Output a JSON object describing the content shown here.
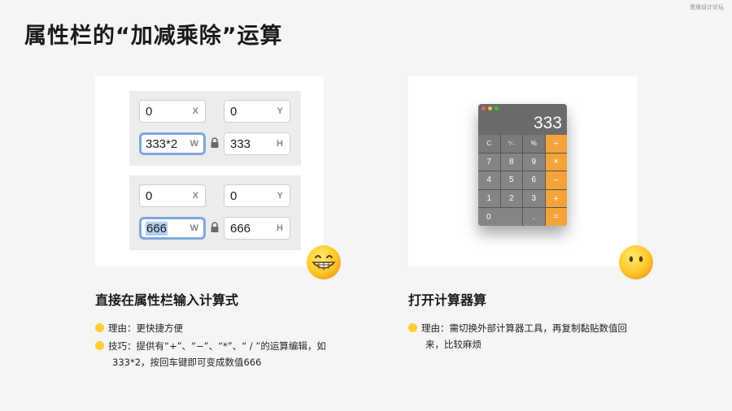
{
  "watermark": "思缘设计论坛",
  "page_title": "属性栏的“加减乘除”运算",
  "left_card": {
    "group1": {
      "x": {
        "value": "0",
        "label": "X"
      },
      "y": {
        "value": "0",
        "label": "Y"
      },
      "w": {
        "value": "333*2",
        "label": "W"
      },
      "h": {
        "value": "333",
        "label": "H"
      }
    },
    "group2": {
      "x": {
        "value": "0",
        "label": "X"
      },
      "y": {
        "value": "0",
        "label": "Y"
      },
      "w": {
        "value": "666",
        "label": "W"
      },
      "h": {
        "value": "666",
        "label": "H"
      }
    },
    "emoji": "grinning-face-emoji"
  },
  "right_card": {
    "calculator": {
      "display": "333",
      "keys": [
        "C",
        "⁺∕₋",
        "%",
        "÷",
        "7",
        "8",
        "9",
        "×",
        "4",
        "5",
        "6",
        "−",
        "1",
        "2",
        "3",
        "+",
        "0",
        ".",
        "="
      ]
    },
    "emoji": "neutral-face-emoji"
  },
  "left_section": {
    "title": "直接在属性栏输入计算式",
    "reason": "理由：更快捷方便",
    "tip_line1": "技巧：提供有“+”、“−”、“*”、“ / ”的运算编辑，如",
    "tip_line2": "333*2，按回车键即可变成数值666"
  },
  "right_section": {
    "title": "打开计算器算",
    "reason_line1": "理由：需切换外部计算器工具，再复制黏贴数值回",
    "reason_line2": "来，比较麻烦"
  },
  "colors": {
    "accent_blue": "#7fa6e0",
    "calc_orange": "#f4a33a",
    "emoji_yellow": "#ffc928"
  }
}
